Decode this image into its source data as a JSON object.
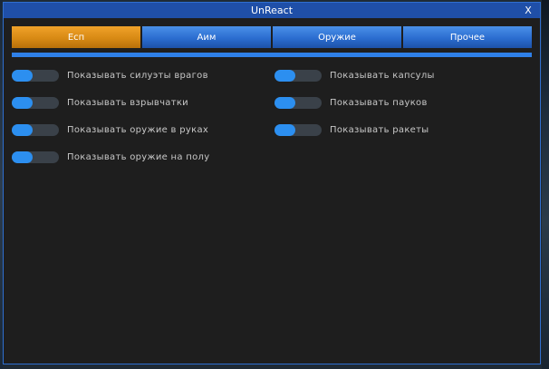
{
  "window": {
    "title": "UnReact",
    "close_label": "X"
  },
  "tabs": [
    {
      "label": "Есп",
      "active": true
    },
    {
      "label": "Аим",
      "active": false
    },
    {
      "label": "Оружие",
      "active": false
    },
    {
      "label": "Прочее",
      "active": false
    }
  ],
  "colors": {
    "accent_blue": "#2c8ff0",
    "active_tab": "#e09418",
    "panel_bg": "#1e1e1e"
  },
  "options_left": [
    {
      "label": "Показывать силуэты врагов",
      "on": true,
      "level": 0.45
    },
    {
      "label": "Показывать взрывчатки",
      "on": true,
      "level": 0.45
    },
    {
      "label": "Показывать оружие в руках",
      "on": true,
      "level": 0.45
    },
    {
      "label": "Показывать оружие на полу",
      "on": true,
      "level": 0.45
    }
  ],
  "options_right": [
    {
      "label": "Показывать капсулы",
      "on": true,
      "level": 0.45
    },
    {
      "label": "Показывать пауков",
      "on": true,
      "level": 0.45
    },
    {
      "label": "Показывать ракеты",
      "on": true,
      "level": 0.45
    }
  ]
}
